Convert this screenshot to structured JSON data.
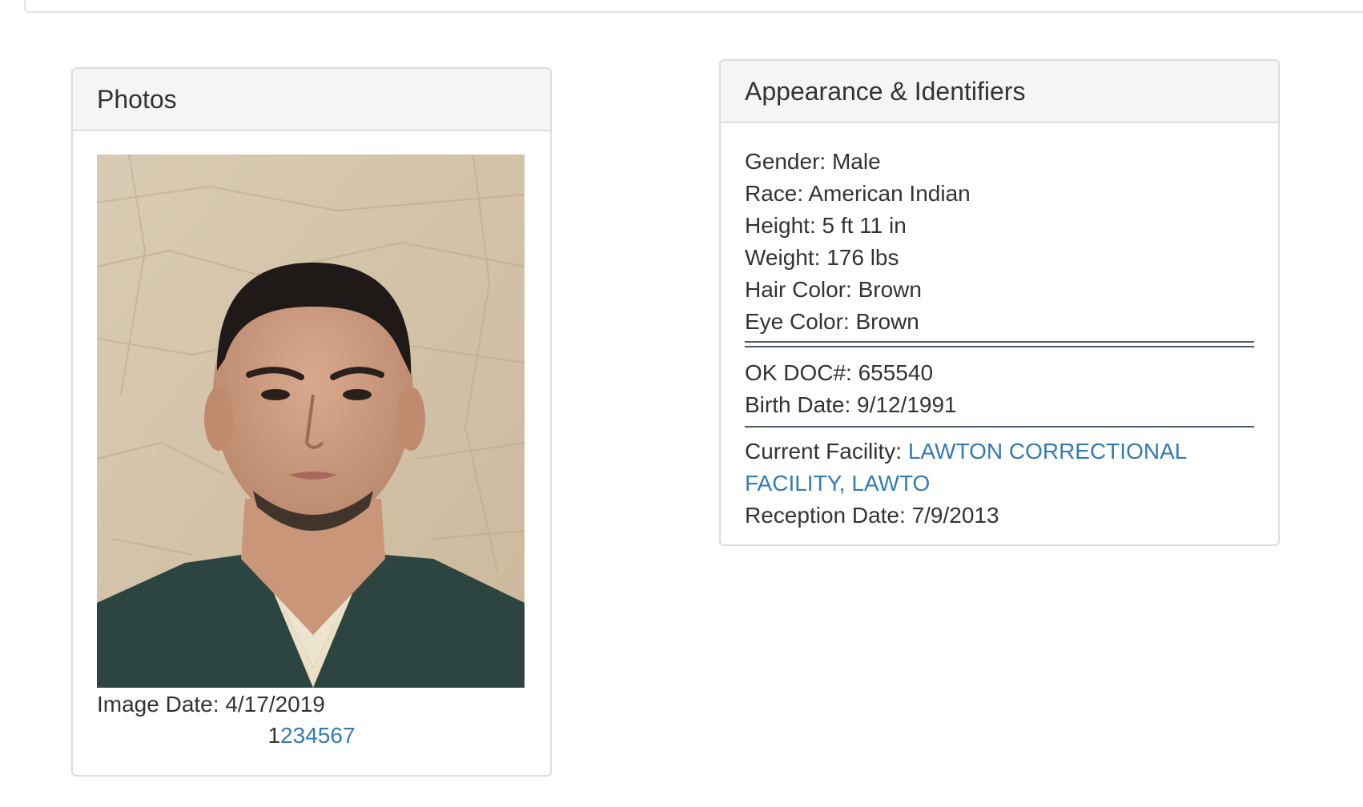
{
  "photos": {
    "heading": "Photos",
    "image_date_label": "Image Date: ",
    "image_date": "4/17/2019",
    "pages": [
      "1",
      "2",
      "3",
      "4",
      "5",
      "6",
      "7"
    ],
    "current_page": "1"
  },
  "appearance": {
    "heading": "Appearance & Identifiers",
    "gender": "Gender: Male",
    "race": "Race: American Indian",
    "height": "Height: 5 ft 11 in",
    "weight": "Weight: 176 lbs",
    "hair_color": "Hair Color: Brown",
    "eye_color": "Eye Color: Brown",
    "doc_number": "OK DOC#: 655540",
    "birth_date": "Birth Date: 9/12/1991",
    "current_facility_label": "Current Facility: ",
    "current_facility": "LAWTON CORRECTIONAL FACILITY, LAWTO",
    "reception_date": "Reception Date: 7/9/2013"
  },
  "colors": {
    "link": "#337ab7",
    "panel_heading_bg": "#f5f5f5",
    "panel_border": "#dddddd",
    "text": "#333333",
    "divider": "#4a5a6a"
  }
}
